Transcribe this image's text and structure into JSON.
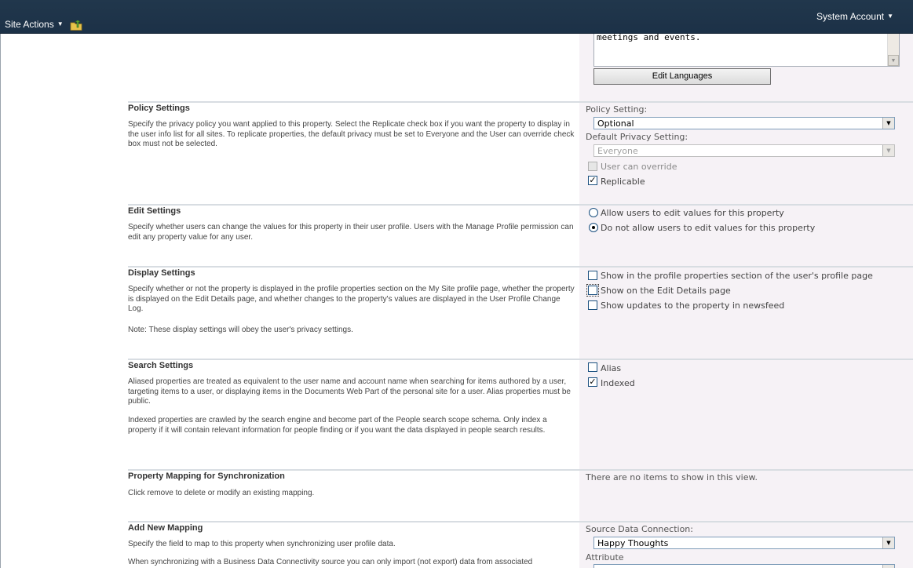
{
  "topbar": {
    "site_actions_label": "Site Actions",
    "user_label": "System Account"
  },
  "colors": {
    "topbar": "#21374c",
    "right_panel": "#f6f2f6",
    "separator": "#d8dde2"
  },
  "description_box": {
    "text": "meetings and events.",
    "edit_languages_button": "Edit Languages"
  },
  "policy": {
    "title": "Policy Settings",
    "description": "Specify the privacy policy you want applied to this property. Select the Replicate check box if you want the property to display in the user info list for all sites. To replicate properties, the default privacy must be set to Everyone and the User can override check box must not be selected.",
    "policy_setting_label": "Policy Setting:",
    "policy_setting_value": "Optional",
    "default_privacy_label": "Default Privacy Setting:",
    "default_privacy_value": "Everyone",
    "user_can_override_label": "User can override",
    "user_can_override_checked": false,
    "replicable_label": "Replicable",
    "replicable_checked": true
  },
  "edit": {
    "title": "Edit Settings",
    "description": "Specify whether users can change the values for this property in their user profile. Users with the Manage Profile permission can edit any property value for any user.",
    "allow_label": "Allow users to edit values for this property",
    "deny_label": "Do not allow users to edit values for this property",
    "selected": "deny"
  },
  "display": {
    "title": "Display Settings",
    "description": "Specify whether or not the property is displayed in the profile properties section on the My Site profile page, whether the property is displayed on the Edit Details page, and whether changes to the property's values are displayed in the User Profile Change Log.",
    "note": "Note: These display settings will obey the user's privacy settings.",
    "show_profile_label": "Show in the profile properties section of the user's profile page",
    "show_edit_details_label": "Show on the Edit Details page",
    "show_newsfeed_label": "Show updates to the property in newsfeed"
  },
  "search": {
    "title": "Search Settings",
    "description1": "Aliased properties are treated as equivalent to the user name and account name when searching for items authored by a user, targeting items to a user, or displaying items in the Documents Web Part of the personal site for a user. Alias properties must be public.",
    "description2": "Indexed properties are crawled by the search engine and become part of the People search scope schema. Only index a property if it will contain relevant information for people finding or if you want the data displayed in people search results.",
    "alias_label": "Alias",
    "alias_checked": false,
    "indexed_label": "Indexed",
    "indexed_checked": true
  },
  "mapping": {
    "title": "Property Mapping for Synchronization",
    "description": "Click remove to delete or modify an existing mapping.",
    "empty_text": "There are no items to show in this view."
  },
  "add_mapping": {
    "title": "Add New Mapping",
    "description1": "Specify the field to map to this property when synchronizing user profile data.",
    "description2": "When synchronizing with a Business Data Connectivity source you can only import (not export) data from associated",
    "source_label": "Source Data Connection:",
    "source_value": "Happy Thoughts",
    "attribute_label": "Attribute"
  }
}
